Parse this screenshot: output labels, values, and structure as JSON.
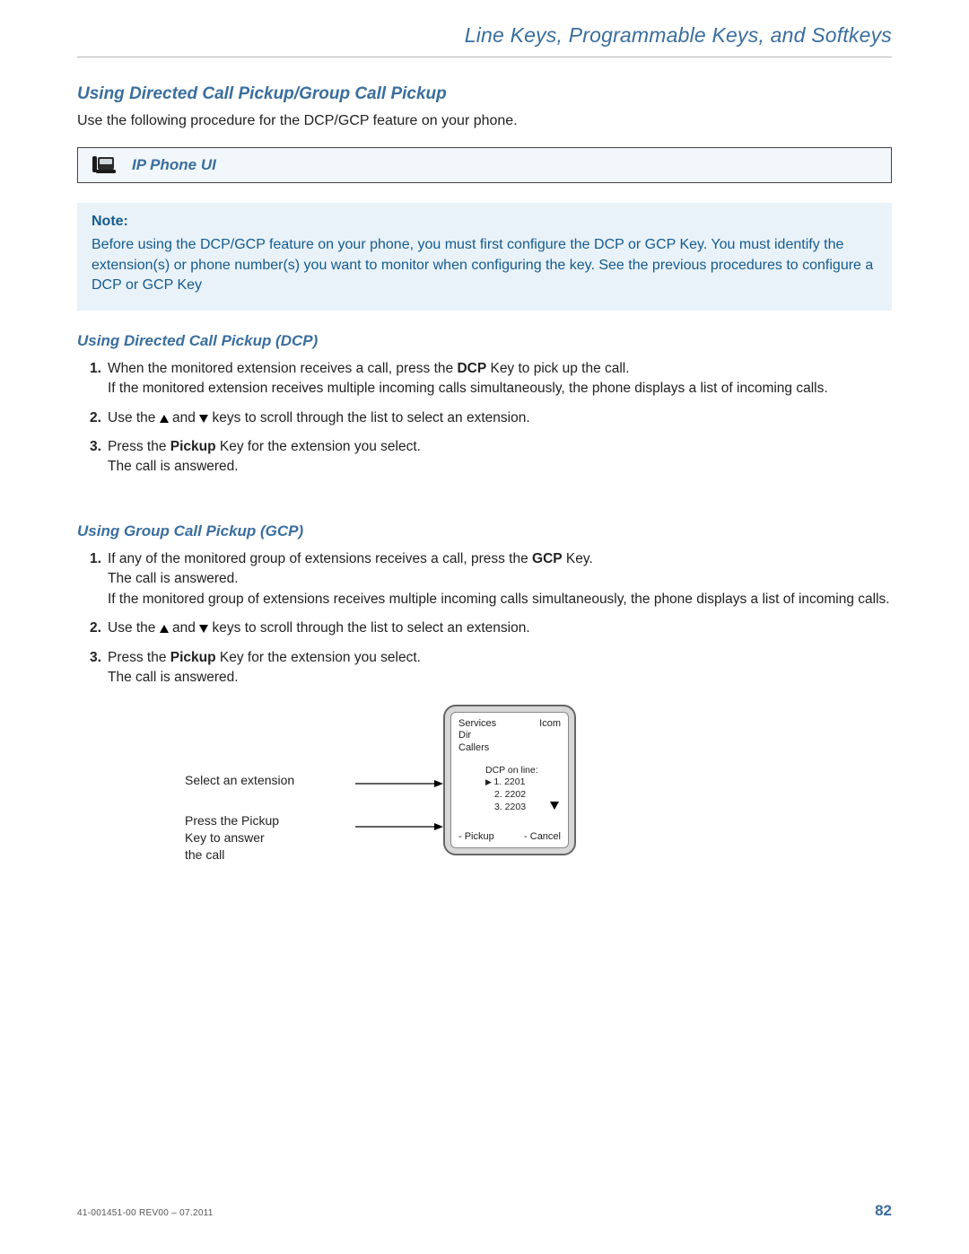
{
  "header": {
    "title": "Line Keys, Programmable Keys, and Softkeys"
  },
  "section": {
    "heading": "Using Directed Call Pickup/Group Call Pickup",
    "lead": "Use the following procedure for the DCP/GCP feature on your phone."
  },
  "callout": {
    "label": "IP Phone UI"
  },
  "note": {
    "head": "Note:",
    "body": "Before using the DCP/GCP feature on your phone, you must first configure the DCP or GCP Key. You must identify the extension(s) or phone number(s) you want to monitor when configuring the key. See the previous procedures to configure a DCP or GCP Key"
  },
  "dcp": {
    "heading": "Using Directed Call Pickup (DCP)",
    "steps": {
      "s1a": "When the monitored extension receives a call, press the ",
      "s1b": "DCP",
      "s1c": " Key to pick up the call.",
      "s1d": "If the monitored extension receives multiple incoming calls simultaneously, the phone displays a list of incoming calls.",
      "s2a": "Use the ",
      "s2b": " and ",
      "s2c": " keys to scroll through the list to select an extension.",
      "s3a": "Press the ",
      "s3b": "Pickup",
      "s3c": " Key for the extension you select.",
      "s3d": "The call is answered."
    }
  },
  "gcp": {
    "heading": "Using Group Call Pickup (GCP)",
    "steps": {
      "s1a": "If any of the monitored group of extensions receives a call, press the ",
      "s1b": "GCP",
      "s1c": " Key.",
      "s1d": "The call is answered.",
      "s1e": "If the monitored group of extensions receives multiple incoming calls simultaneously, the phone displays a list of incoming calls.",
      "s2a": "Use the ",
      "s2b": " and ",
      "s2c": " keys to scroll through the list to select an extension.",
      "s3a": "Press the ",
      "s3b": "Pickup",
      "s3c": " Key for the extension you select.",
      "s3d": "The call is answered."
    }
  },
  "figure": {
    "label1": "Select an extension",
    "label2a": "Press the Pickup",
    "label2b": "Key to answer",
    "label2c": "the call",
    "screen": {
      "left1": "Services",
      "left2": "Dir",
      "left3": "Callers",
      "right_top": "Icom",
      "mid_title": "DCP on line:",
      "mid1": "1. 2201",
      "mid2": "2. 2202",
      "mid3": "3. 2203",
      "bottom_left": "- Pickup",
      "bottom_right": "- Cancel"
    }
  },
  "footer": {
    "docid": "41-001451-00 REV00 – 07.2011",
    "page": "82"
  }
}
